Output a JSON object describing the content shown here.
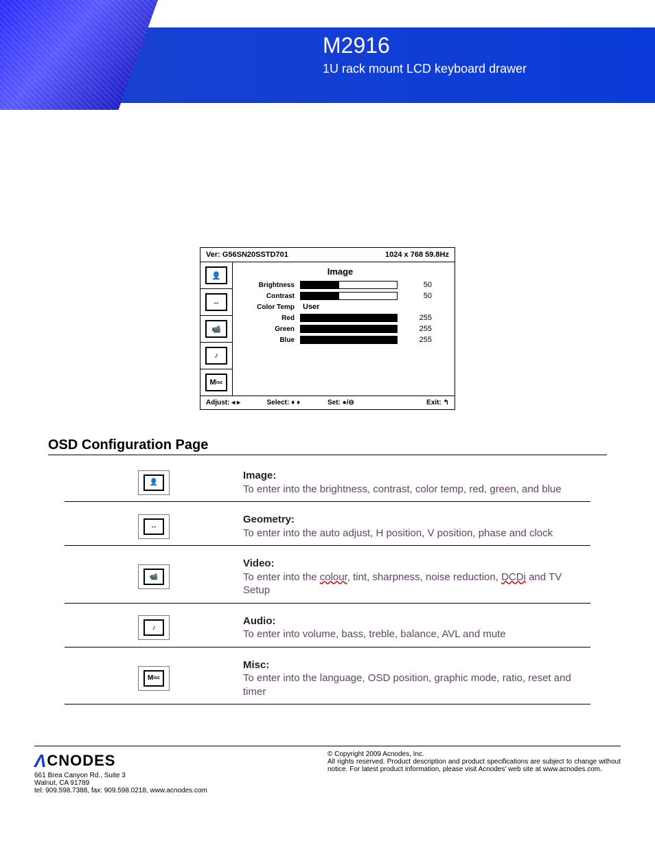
{
  "header": {
    "model": "M2916",
    "subtitle": "1U rack mount LCD keyboard drawer"
  },
  "osd": {
    "version_label": "Ver: G56SN20SSTD701",
    "resolution": "1024 x 768  59.8Hz",
    "heading": "Image",
    "rows": {
      "brightness": {
        "label": "Brightness",
        "value": "50",
        "pct": 40
      },
      "contrast": {
        "label": "Contrast",
        "value": "50",
        "pct": 40
      },
      "colortemp": {
        "label": "Color Temp",
        "value": "User"
      },
      "red": {
        "label": "Red",
        "value": "255",
        "pct": 100
      },
      "green": {
        "label": "Green",
        "value": "255",
        "pct": 100
      },
      "blue": {
        "label": "Blue",
        "value": "255",
        "pct": 100
      }
    },
    "footer": {
      "adjust": "Adjust: ◂ ▸",
      "select": "Select: ♦ ♦",
      "set": "Set: ●/⊖",
      "exit": "Exit: ↰"
    },
    "tabs": {
      "image": "👤",
      "geometry": "↔",
      "video": "📹",
      "audio": "♪",
      "misc": "M"
    }
  },
  "section": {
    "title": "OSD Configuration Page",
    "items": [
      {
        "icon": "👤",
        "name": "image",
        "label": "Image:",
        "desc": "To enter into the brightness, contrast, color temp, red, green, and blue"
      },
      {
        "icon": "↔",
        "name": "geometry",
        "label": "Geometry:",
        "desc": "To enter into the auto adjust, H position, V position, phase and clock"
      },
      {
        "icon": "📹",
        "name": "video",
        "label": "Video:",
        "desc_html": "To enter into the <span class='squig'>colour</span>, tint, sharpness, noise reduction, <span class='squig'>DCDi</span> and TV Setup"
      },
      {
        "icon": "♪",
        "name": "audio",
        "label": "Audio:",
        "desc": "To enter into volume, bass, treble, balance, AVL and mute"
      },
      {
        "icon": "M",
        "name": "misc",
        "label": "Misc:",
        "desc": "To enter into the language, OSD position, graphic mode, ratio, reset and timer"
      }
    ]
  },
  "footer": {
    "company": "CNODES",
    "addr1": "661 Brea Canyon Rd., Suite 3",
    "addr2": "Walnut, CA 91789",
    "contact": "tel: 909.598.7388, fax: 909.598.0218, www.acnodes.com",
    "copy": "© Copyright 2009 Acnodes, Inc.",
    "legal": "All rights reserved. Product description and product specifications are subject to change without notice. For latest product information, please visit Acnodes' web site at www.acnodes.com."
  }
}
